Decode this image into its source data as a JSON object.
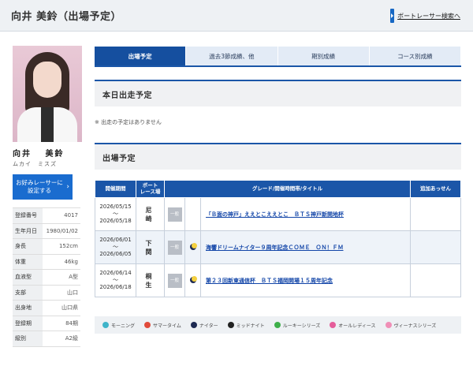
{
  "header": {
    "title": "向井 美鈴（出場予定）",
    "back_link": "ボートレーサー検索へ"
  },
  "profile": {
    "name_kanji": "向井　 美鈴",
    "name_kana": "ムカイ　ミスズ",
    "favorite_button": "お好みレーサーに\n設定する",
    "info": [
      {
        "key": "登録番号",
        "value": "4017"
      },
      {
        "key": "生年月日",
        "value": "1980/01/02"
      },
      {
        "key": "身長",
        "value": "152cm"
      },
      {
        "key": "体重",
        "value": "46kg"
      },
      {
        "key": "血液型",
        "value": "A型"
      },
      {
        "key": "支部",
        "value": "山口"
      },
      {
        "key": "出身地",
        "value": "山口県"
      },
      {
        "key": "登録期",
        "value": "84期"
      },
      {
        "key": "級別",
        "value": "A2級"
      }
    ]
  },
  "tabs": [
    {
      "label": "出場予定",
      "active": true
    },
    {
      "label": "過去3節成績、他",
      "active": false
    },
    {
      "label": "期別成績",
      "active": false
    },
    {
      "label": "コース別成績",
      "active": false
    }
  ],
  "today_section": {
    "title": "本日出走予定",
    "note": "※ 出走の予定はありません"
  },
  "schedule_section": {
    "title": "出場予定",
    "headers": {
      "period": "開催期間",
      "venue": "ボート\nレース場",
      "title": "グレード/開催時間帯/タイトル",
      "extra": "追加あっせん"
    },
    "rows": [
      {
        "start": "2026/05/15",
        "tilde": "～",
        "end": "2026/05/18",
        "venue": "尼　崎",
        "grade": "一般",
        "night": false,
        "title": "「Ｂ面の神戸」ええとこええとこ　ＢＴＳ神戸新開地杯",
        "extra": ""
      },
      {
        "start": "2026/06/01",
        "tilde": "～",
        "end": "2026/06/05",
        "venue": "下　関",
        "grade": "一般",
        "night": true,
        "title": "海響ドリームナイター９周年記念ＣＯＭＥ　ＯＮ！ＦＭ",
        "extra": ""
      },
      {
        "start": "2026/06/14",
        "tilde": "～",
        "end": "2026/06/18",
        "venue": "桐　生",
        "grade": "一般",
        "night": true,
        "title": "第２３回新東通信杯　ＢＴＳ福岡開場１５周年記念",
        "extra": ""
      }
    ]
  },
  "legend": [
    {
      "label": "モーニング",
      "color": "#3fb4c9"
    },
    {
      "label": "サマータイム",
      "color": "#e14b3b"
    },
    {
      "label": "ナイター",
      "color": "#1d2a52"
    },
    {
      "label": "ミッドナイト",
      "color": "#222222"
    },
    {
      "label": "ルーキーシリーズ",
      "color": "#3eaf4a"
    },
    {
      "label": "オールレディース",
      "color": "#e55d9a"
    },
    {
      "label": "ヴィーナスシリーズ",
      "color": "#f08fb7"
    }
  ]
}
